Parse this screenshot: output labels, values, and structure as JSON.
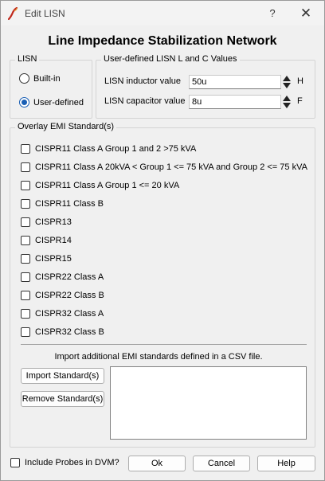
{
  "window": {
    "title": "Edit LISN",
    "help_label": "?",
    "close_label": "✕"
  },
  "heading": "Line Impedance Stabilization Network",
  "lisn_group": {
    "legend": "LISN",
    "options": [
      {
        "label": "Built-in",
        "checked": false
      },
      {
        "label": "User-defined",
        "checked": true
      }
    ]
  },
  "user_values": {
    "legend": "User-defined LISN L and C Values",
    "inductor": {
      "label": "LISN inductor value",
      "value": "50u",
      "unit": "H"
    },
    "capacitor": {
      "label": "LISN capacitor value",
      "value": "8u",
      "unit": "F"
    }
  },
  "overlay": {
    "legend": "Overlay EMI Standard(s)",
    "standards": [
      "CISPR11 Class A Group 1 and 2 >75 kVA",
      "CISPR11 Class A 20kVA < Group 1 <= 75 kVA and Group 2 <= 75 kVA",
      "CISPR11 Class A Group 1 <= 20 kVA",
      "CISPR11 Class B",
      "CISPR13",
      "CISPR14",
      "CISPR15",
      "CISPR22 Class A",
      "CISPR22 Class B",
      "CISPR32 Class A",
      "CISPR32 Class B"
    ],
    "import_note": "Import additional EMI standards defined in a CSV file.",
    "import_button": "Import Standard(s)",
    "remove_button": "Remove Standard(s)"
  },
  "footer": {
    "include_probes_label": "Include Probes in DVM?",
    "ok_label": "Ok",
    "cancel_label": "Cancel",
    "help_label": "Help"
  },
  "colors": {
    "radio_accent": "#1a5fb4",
    "app_icon": "#c0281c"
  },
  "icons": {
    "app": "ltspice-pen-icon",
    "spinner": "up-down-arrows-icon"
  }
}
